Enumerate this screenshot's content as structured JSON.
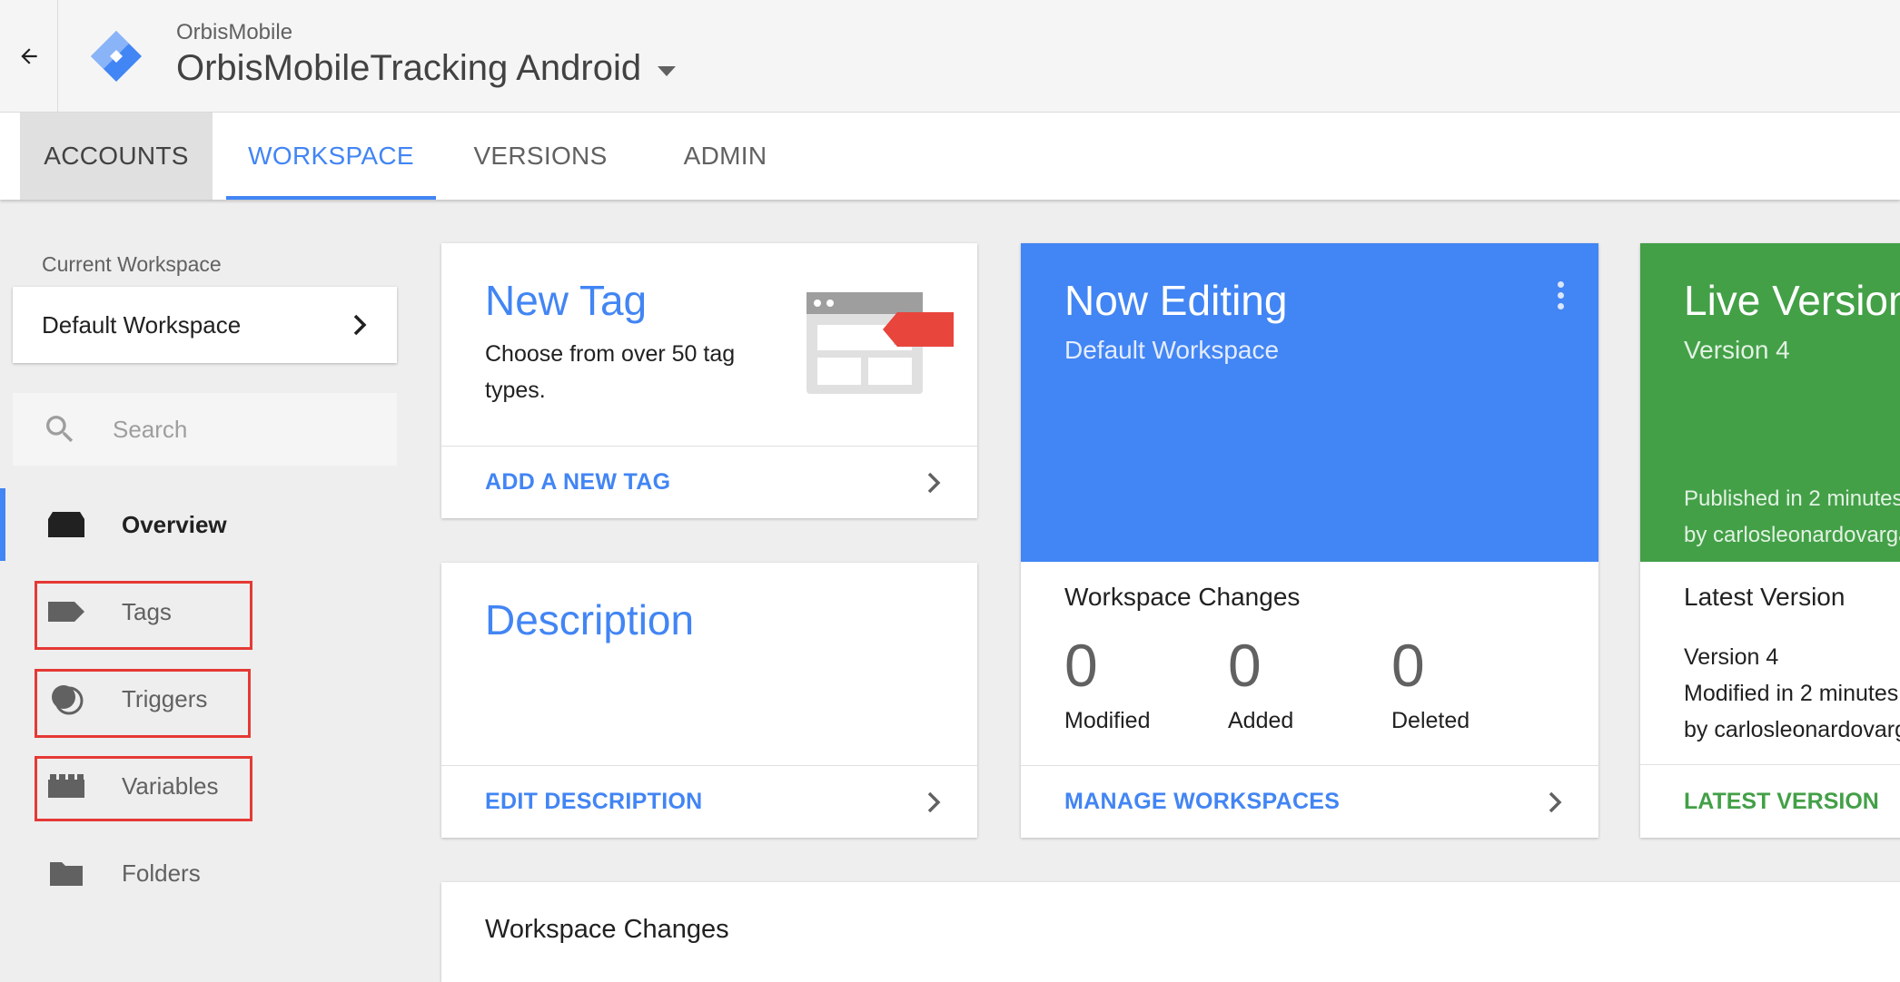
{
  "header": {
    "back_icon": "arrow-back-icon",
    "logo_icon": "gtm-diamond-logo",
    "account_name": "OrbisMobile",
    "container_name": "OrbisMobileTracking Android",
    "container_dropdown_icon": "caret-down-icon"
  },
  "tabs": [
    {
      "label": "ACCOUNTS",
      "state": "highlighted"
    },
    {
      "label": "WORKSPACE",
      "state": "active"
    },
    {
      "label": "VERSIONS",
      "state": "default"
    },
    {
      "label": "ADMIN",
      "state": "default"
    }
  ],
  "sidebar": {
    "current_workspace_label": "Current Workspace",
    "workspace_name": "Default Workspace",
    "search_placeholder": "Search",
    "items": [
      {
        "label": "Overview",
        "icon": "overview-icon",
        "active": true
      },
      {
        "label": "Tags",
        "icon": "tag-icon",
        "highlighted": true
      },
      {
        "label": "Triggers",
        "icon": "trigger-icon",
        "highlighted": true
      },
      {
        "label": "Variables",
        "icon": "variable-icon",
        "highlighted": true
      },
      {
        "label": "Folders",
        "icon": "folder-icon"
      }
    ]
  },
  "new_tag_card": {
    "title": "New Tag",
    "description": "Choose from over 50 tag types.",
    "action": "ADD A NEW TAG"
  },
  "description_card": {
    "title": "Description",
    "action": "EDIT DESCRIPTION"
  },
  "now_editing_card": {
    "title": "Now Editing",
    "workspace": "Default Workspace",
    "changes_label": "Workspace Changes",
    "stats": [
      {
        "value": "0",
        "label": "Modified"
      },
      {
        "value": "0",
        "label": "Added"
      },
      {
        "value": "0",
        "label": "Deleted"
      }
    ],
    "action": "MANAGE WORKSPACES"
  },
  "live_version_card": {
    "title": "Live Version",
    "version": "Version 4",
    "published_line1": "Published in 2 minutes",
    "published_line2": "by carlosleonardovargas",
    "latest_label": "Latest Version",
    "latest_version": "Version 4",
    "modified_line": "Modified in 2 minutes",
    "modified_by": "by carlosleonardovargas",
    "action": "LATEST VERSION"
  },
  "workspace_changes_card": {
    "title": "Workspace Changes"
  },
  "colors": {
    "primary_blue": "#4285f4",
    "live_green": "#43a047",
    "highlight_red": "#e53935",
    "tag_red": "#e8453c",
    "background": "#eeeeee"
  }
}
